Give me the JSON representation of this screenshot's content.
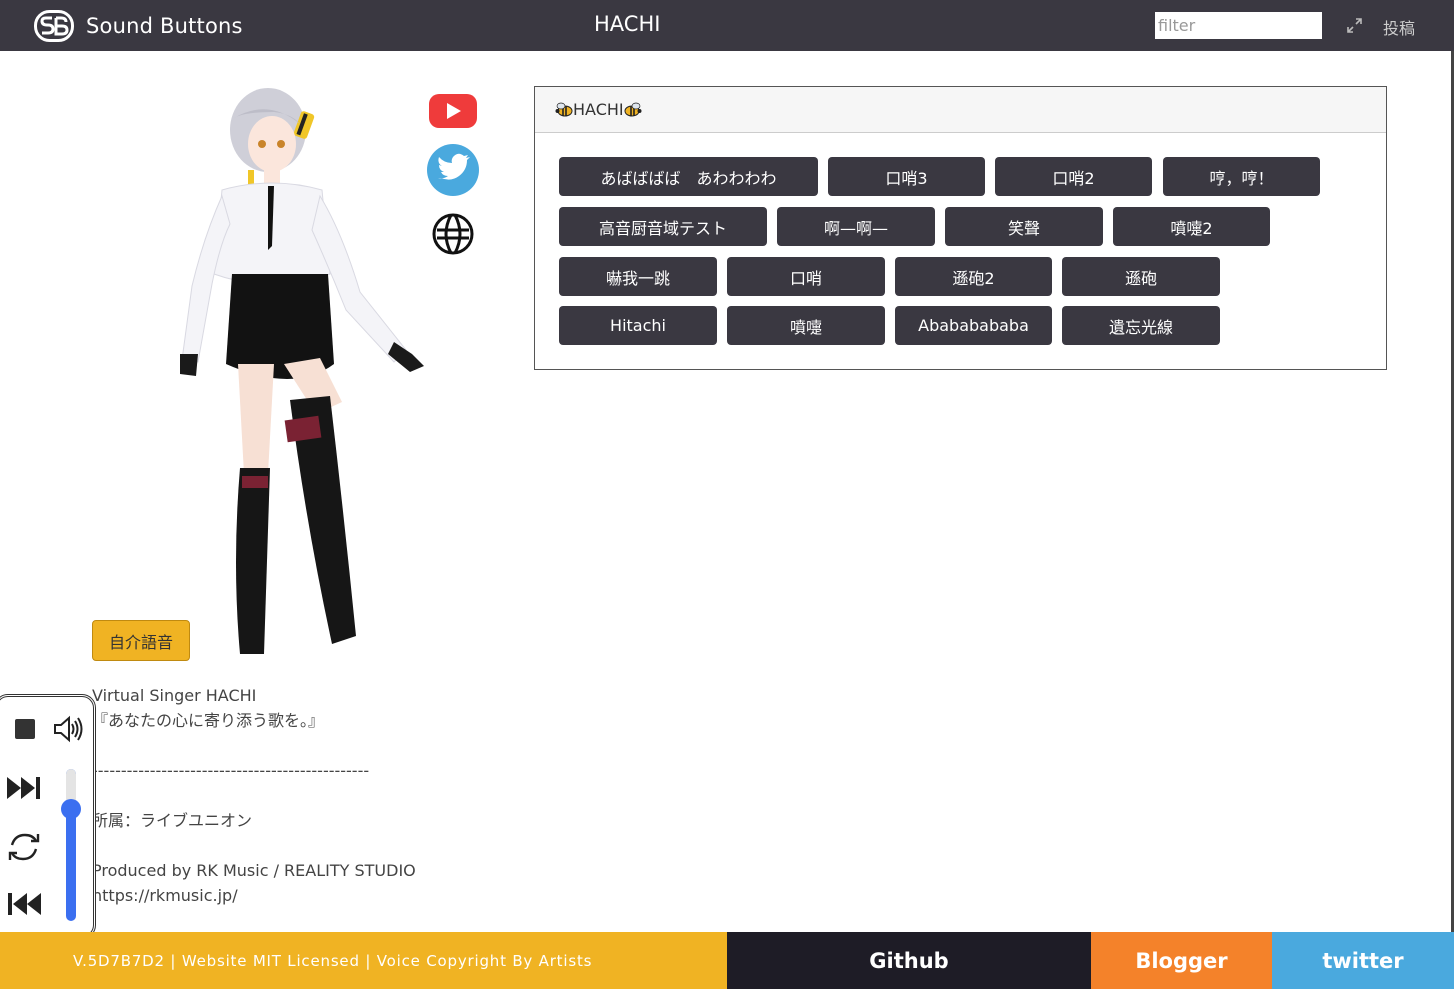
{
  "header": {
    "brand": "Sound Buttons",
    "title": "HACHI",
    "filter_placeholder": "filter",
    "post_label": "投稿",
    "bg_color": "#3a3841"
  },
  "profile": {
    "intro_button": "自介語音",
    "description_lines": [
      "Virtual Singer HACHI",
      "『あなたの心に寄り添う歌を。』",
      "",
      "------------------------------------------------",
      "",
      "所属：ライブユニオン",
      "",
      "Produced by RK Music / REALITY STUDIO",
      "https://rkmusic.jp/"
    ],
    "social_icons": [
      "youtube-icon",
      "twitter-icon",
      "website-icon"
    ]
  },
  "player": {
    "volume": 0.77,
    "accent": "#3b6ff0"
  },
  "card": {
    "title": "HACHI",
    "title_icon": "bee-icon",
    "buttons": [
      "あばばばば　あわわわわ",
      "口哨3",
      "口哨2",
      "哼，哼！",
      "高音厨音域テスト",
      "啊—啊—",
      "笑聲",
      "噴嚏2",
      "嚇我一跳",
      "口哨",
      "遜砲2",
      "遜砲",
      "Hitachi",
      "噴嚏",
      "Abababababa",
      "遺忘光線"
    ]
  },
  "footer": {
    "credit": "V.5D7B7D2 | Website MIT Licensed | Voice Copyright By Artists",
    "github": "Github",
    "blogger": "Blogger",
    "twitter": "twitter",
    "colors": {
      "credit": "#f0b323",
      "github": "#1e1c26",
      "blogger": "#f4822a",
      "twitter": "#4aa9de"
    }
  }
}
